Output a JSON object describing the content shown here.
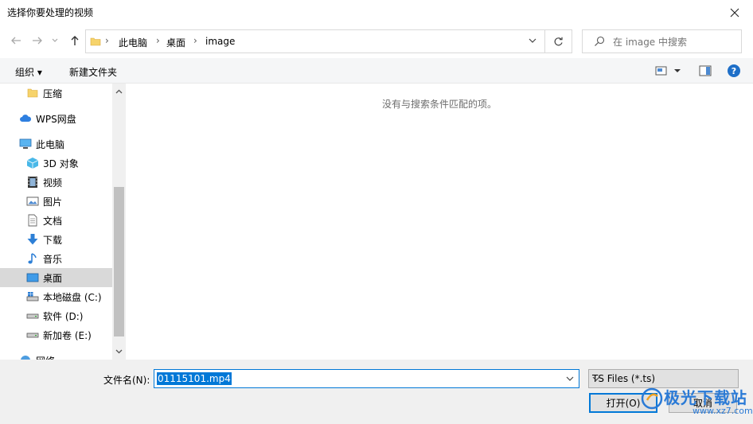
{
  "window": {
    "title": "选择你要处理的视频"
  },
  "address": {
    "crumbs": [
      "此电脑",
      "桌面",
      "image"
    ]
  },
  "search": {
    "placeholder": "在 image 中搜索"
  },
  "toolbar": {
    "organize": "组织 ▾",
    "new_folder": "新建文件夹",
    "help": "?"
  },
  "nav": {
    "items": [
      {
        "label": "压缩",
        "icon": "folder-icon"
      },
      {
        "label": "WPS网盘",
        "icon": "cloud-icon"
      },
      {
        "label": "此电脑",
        "icon": "computer-icon"
      },
      {
        "label": "3D 对象",
        "icon": "cube-icon"
      },
      {
        "label": "视频",
        "icon": "video-icon"
      },
      {
        "label": "图片",
        "icon": "picture-icon"
      },
      {
        "label": "文档",
        "icon": "document-icon"
      },
      {
        "label": "下载",
        "icon": "download-icon"
      },
      {
        "label": "音乐",
        "icon": "music-icon"
      },
      {
        "label": "桌面",
        "icon": "desktop-icon",
        "selected": true
      },
      {
        "label": "本地磁盘 (C:)",
        "icon": "drive-c-icon"
      },
      {
        "label": "软件 (D:)",
        "icon": "drive-icon"
      },
      {
        "label": "新加卷 (E:)",
        "icon": "drive-icon"
      },
      {
        "label": "网络",
        "icon": "network-icon"
      }
    ]
  },
  "content": {
    "empty_message": "没有与搜索条件匹配的项。"
  },
  "footer": {
    "filename_label": "文件名(N):",
    "filename_value": "01115101.mp4",
    "filter_value": "TS Files (*.ts)",
    "open_label": "打开(O)",
    "cancel_label": "取消"
  },
  "watermark": {
    "brand": "极光下载站",
    "url": "www.xz7.com"
  },
  "colors": {
    "accent": "#0078d7",
    "selected_nav": "#d9d9d9",
    "bottom_bg": "#f0f0f0"
  }
}
